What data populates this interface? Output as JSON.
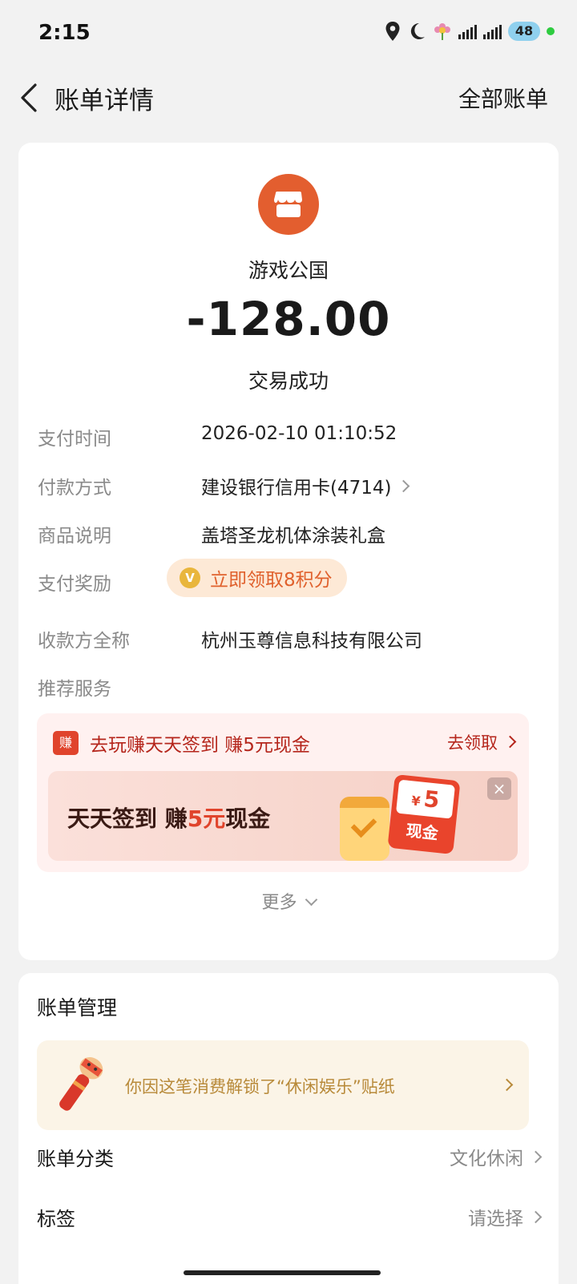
{
  "status_bar": {
    "time": "2:15",
    "battery": "48"
  },
  "nav": {
    "title": "账单详情",
    "all_bills": "全部账单"
  },
  "bill": {
    "merchant": "游戏公国",
    "amount": "-128.00",
    "status": "交易成功",
    "rows": [
      {
        "label": "支付时间",
        "value": "2026-02-10 01:10:52"
      },
      {
        "label": "付款方式",
        "value": "建设银行信用卡(4714)"
      },
      {
        "label": "商品说明",
        "value": "盖塔圣龙机体涂装礼盒"
      },
      {
        "label": "支付奖励",
        "value": "立即领取8积分"
      },
      {
        "label": "收款方全称",
        "value": "杭州玉尊信息科技有限公司"
      },
      {
        "label": "推荐服务",
        "value": ""
      }
    ],
    "reward_coin": "V"
  },
  "promo": {
    "icon_text": "赚",
    "head": "去玩赚天天签到 赚5元现金",
    "action": "去领取",
    "banner_pre": "天天签到 赚",
    "banner_hl": "5元",
    "banner_post": "现金",
    "cash_symbol": "¥",
    "cash_amount": "5",
    "cash_label": "现金",
    "close": "×"
  },
  "more": "更多",
  "management": {
    "title": "账单管理",
    "sticker_text": "你因这笔消费解锁了“休闲娱乐”贴纸",
    "category_label": "账单分类",
    "category_value": "文化休闲",
    "tag_label": "标签",
    "tag_value": "请选择"
  },
  "colors": {
    "accent": "#e35e2f",
    "promo_red": "#b5261c",
    "reward_orange": "#e0612d"
  }
}
